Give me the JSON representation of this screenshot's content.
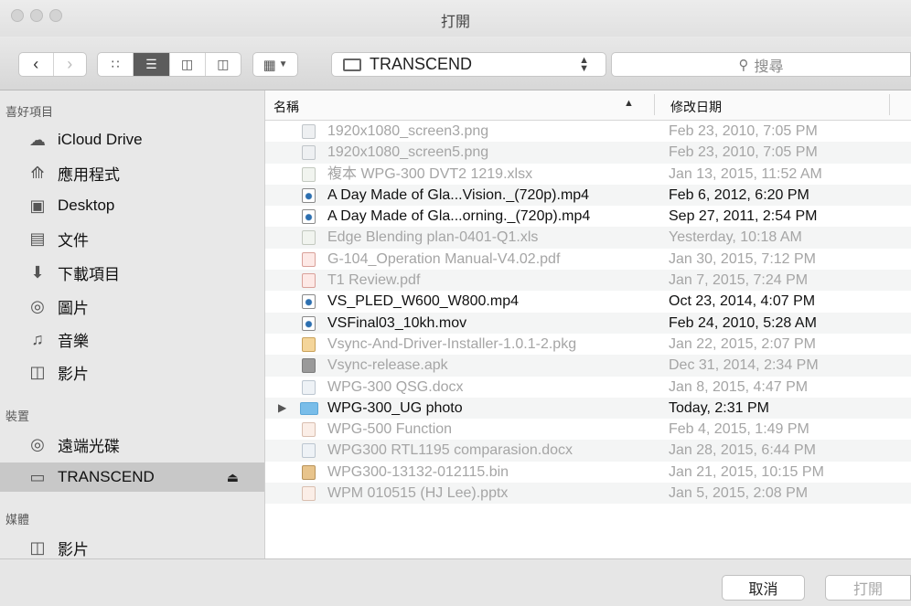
{
  "window": {
    "title": "打開"
  },
  "toolbar": {
    "location": "TRANSCEND",
    "search_placeholder": "搜尋"
  },
  "sidebar": {
    "sections": [
      {
        "title": "喜好項目",
        "items": [
          {
            "label": "iCloud Drive",
            "icon": "cloud-icon"
          },
          {
            "label": "應用程式",
            "icon": "applications-icon"
          },
          {
            "label": "Desktop",
            "icon": "desktop-icon"
          },
          {
            "label": "文件",
            "icon": "documents-icon"
          },
          {
            "label": "下載項目",
            "icon": "downloads-icon"
          },
          {
            "label": "圖片",
            "icon": "pictures-icon"
          },
          {
            "label": "音樂",
            "icon": "music-icon"
          },
          {
            "label": "影片",
            "icon": "movies-icon"
          }
        ]
      },
      {
        "title": "裝置",
        "items": [
          {
            "label": "遠端光碟",
            "icon": "disc-icon"
          },
          {
            "label": "TRANSCEND",
            "icon": "drive-icon",
            "selected": true
          }
        ]
      },
      {
        "title": "媒體",
        "items": [
          {
            "label": "影片",
            "icon": "movies-icon"
          }
        ]
      }
    ]
  },
  "list": {
    "col_name": "名稱",
    "col_date": "修改日期",
    "files": [
      {
        "name": "1920x1080_screen3.png",
        "date": "Feb 23, 2010, 7:05 PM",
        "enabled": false,
        "type": "image"
      },
      {
        "name": "1920x1080_screen5.png",
        "date": "Feb 23, 2010, 7:05 PM",
        "enabled": false,
        "type": "image"
      },
      {
        "name": "複本 WPG-300 DVT2 1219.xlsx",
        "date": "Jan 13, 2015, 11:52 AM",
        "enabled": false,
        "type": "sheet"
      },
      {
        "name": "A Day Made of Gla...Vision._(720p).mp4",
        "date": "Feb 6, 2012, 6:20 PM",
        "enabled": true,
        "type": "video"
      },
      {
        "name": "A Day Made of Gla...orning._(720p).mp4",
        "date": "Sep 27, 2011, 2:54 PM",
        "enabled": true,
        "type": "video"
      },
      {
        "name": "Edge Blending plan-0401-Q1.xls",
        "date": "Yesterday, 10:18 AM",
        "enabled": false,
        "type": "sheet"
      },
      {
        "name": "G-104_Operation Manual-V4.02.pdf",
        "date": "Jan 30, 2015, 7:12 PM",
        "enabled": false,
        "type": "pdf"
      },
      {
        "name": "T1 Review.pdf",
        "date": "Jan 7, 2015, 7:24 PM",
        "enabled": false,
        "type": "pdf"
      },
      {
        "name": "VS_PLED_W600_W800.mp4",
        "date": "Oct 23, 2014, 4:07 PM",
        "enabled": true,
        "type": "video"
      },
      {
        "name": "VSFinal03_10kh.mov",
        "date": "Feb 24, 2010, 5:28 AM",
        "enabled": true,
        "type": "video"
      },
      {
        "name": "Vsync-And-Driver-Installer-1.0.1-2.pkg",
        "date": "Jan 22, 2015, 2:07 PM",
        "enabled": false,
        "type": "pkg"
      },
      {
        "name": "Vsync-release.apk",
        "date": "Dec 31, 2014, 2:34 PM",
        "enabled": false,
        "type": "apk"
      },
      {
        "name": "WPG-300 QSG.docx",
        "date": "Jan 8, 2015, 4:47 PM",
        "enabled": false,
        "type": "doc"
      },
      {
        "name": "WPG-300_UG photo",
        "date": "Today, 2:31 PM",
        "enabled": true,
        "type": "folder"
      },
      {
        "name": "WPG-500 Function",
        "date": "Feb 4, 2015, 1:49 PM",
        "enabled": false,
        "type": "keynote"
      },
      {
        "name": "WPG300 RTL1195 comparasion.docx",
        "date": "Jan 28, 2015, 6:44 PM",
        "enabled": false,
        "type": "doc"
      },
      {
        "name": "WPG300-13132-012115.bin",
        "date": "Jan 21, 2015, 10:15 PM",
        "enabled": false,
        "type": "bin"
      },
      {
        "name": "WPM 010515 (HJ Lee).pptx",
        "date": "Jan 5, 2015, 2:08 PM",
        "enabled": false,
        "type": "keynote"
      }
    ]
  },
  "buttons": {
    "cancel": "取消",
    "open": "打開"
  }
}
